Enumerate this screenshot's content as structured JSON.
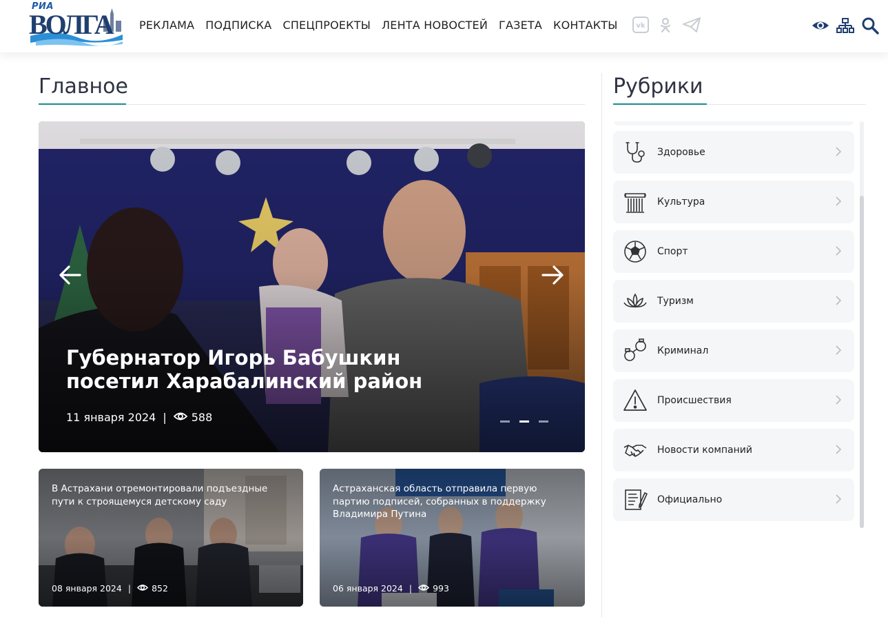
{
  "header": {
    "logo_top": "РИА",
    "logo_main": "ВОЛГА",
    "nav": [
      "РЕКЛАМА",
      "ПОДПИСКА",
      "СПЕЦПРОЕКТЫ",
      "ЛЕНТА НОВОСТЕЙ",
      "ГАЗЕТА",
      "КОНТАКТЫ"
    ],
    "social_icons": [
      "vk-icon",
      "odnoklassniki-icon",
      "telegram-icon"
    ],
    "tool_icons": [
      "eye-icon",
      "sitemap-icon",
      "search-icon"
    ]
  },
  "main": {
    "title": "Главное",
    "hero": {
      "title": "Губернатор Игорь Бабушкин посетил Харабалинский район",
      "date": "11 января 2024",
      "separator": "|",
      "views": "588",
      "slides_count": 3,
      "active_slide": 2
    },
    "cards": [
      {
        "title": "В Астрахани отремонтировали подъездные пути к строящемуся детскому саду",
        "date": "08 января 2024",
        "separator": "|",
        "views": "852"
      },
      {
        "title": "Астраханская область отправила первую партию подписей, собранных в поддержку Владимира Путина",
        "date": "06 января 2024",
        "separator": "|",
        "views": "993"
      }
    ]
  },
  "rubrics": {
    "title": "Рубрики",
    "items": [
      {
        "label": "Здоровье",
        "icon": "stethoscope-icon"
      },
      {
        "label": "Культура",
        "icon": "column-icon"
      },
      {
        "label": "Спорт",
        "icon": "soccer-ball-icon"
      },
      {
        "label": "Туризм",
        "icon": "lotus-icon"
      },
      {
        "label": "Криминал",
        "icon": "handcuffs-icon"
      },
      {
        "label": "Происшествия",
        "icon": "warning-icon"
      },
      {
        "label": "Новости компаний",
        "icon": "handshake-icon"
      },
      {
        "label": "Официально",
        "icon": "document-pen-icon"
      }
    ]
  },
  "colors": {
    "accent": "#1a8a8f",
    "brand_blue": "#1f3f6e",
    "item_bg": "#f5f6f8"
  }
}
